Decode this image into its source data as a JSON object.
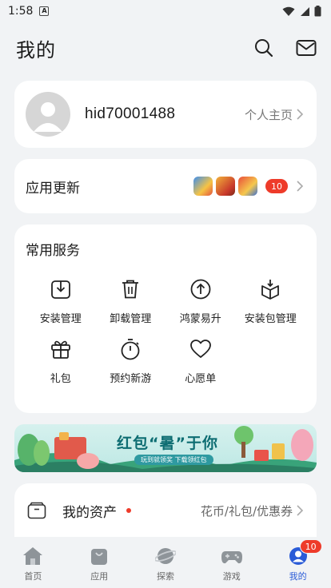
{
  "status_bar": {
    "time": "1:58",
    "notification_glyph": "A"
  },
  "header": {
    "title": "我的"
  },
  "profile": {
    "username": "hid70001488",
    "link_label": "个人主页"
  },
  "updates": {
    "label": "应用更新",
    "count": "10"
  },
  "services": {
    "heading": "常用服务",
    "items": [
      {
        "label": "安装管理",
        "icon": "install-manage-icon"
      },
      {
        "label": "卸载管理",
        "icon": "trash-icon"
      },
      {
        "label": "鸿蒙易升",
        "icon": "upgrade-arrow-icon"
      },
      {
        "label": "安装包管理",
        "icon": "package-box-icon"
      },
      {
        "label": "礼包",
        "icon": "gift-icon"
      },
      {
        "label": "预约新游",
        "icon": "stopwatch-icon"
      },
      {
        "label": "心愿单",
        "icon": "heart-icon"
      }
    ]
  },
  "banner": {
    "title": "红包“暑”于你",
    "subtitle": "玩到就领奖   下载领红包"
  },
  "assets": {
    "label": "我的资产",
    "right_text": "花币/礼包/优惠券"
  },
  "bottom_nav": {
    "items": [
      {
        "label": "首页"
      },
      {
        "label": "应用"
      },
      {
        "label": "探索"
      },
      {
        "label": "游戏"
      },
      {
        "label": "我的",
        "badge": "10"
      }
    ],
    "active": "我的"
  },
  "colors": {
    "accent": "#2a5bd7",
    "badge": "#ee3b2a",
    "background": "#f1f3f5"
  }
}
